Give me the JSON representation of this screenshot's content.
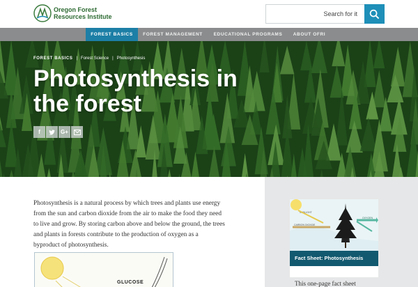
{
  "header": {
    "logo_line1": "Oregon Forest",
    "logo_line2": "Resources Institute",
    "search_placeholder": "Search for it"
  },
  "nav": {
    "items": [
      {
        "label": "FOREST BASICS",
        "active": true
      },
      {
        "label": "FOREST MANAGEMENT",
        "active": false
      },
      {
        "label": "EDUCATIONAL PROGRAMS",
        "active": false
      },
      {
        "label": "ABOUT OFRI",
        "active": false
      }
    ]
  },
  "hero": {
    "breadcrumb": [
      "FOREST BASICS",
      "Forest Science",
      "Photosynthesis"
    ],
    "title": "Photosynthesis in the forest",
    "share": [
      "f",
      "t",
      "G+",
      "mail"
    ]
  },
  "article": {
    "intro": "Photosynthesis is a natural process by which trees and plants use energy from the sun and carbon dioxide from the air to make the food they need to live and grow. By storing carbon above and below the ground, the trees and plants in forests contribute to the production of oxygen as a byproduct of photosynthesis.",
    "diagram_label": "GLUCOSE"
  },
  "sidebar": {
    "card_title": "Fact Sheet: Photosynthesis",
    "card_desc": "This one-page fact sheet",
    "img_labels": [
      "SUNLIGHT",
      "CARBON DIOXIDE",
      "OXYGEN"
    ]
  },
  "colors": {
    "accent": "#1d7fa6",
    "nav_bg": "#8a8c8d",
    "card_title_bg": "#12596f",
    "logo_green": "#2e6b33"
  }
}
